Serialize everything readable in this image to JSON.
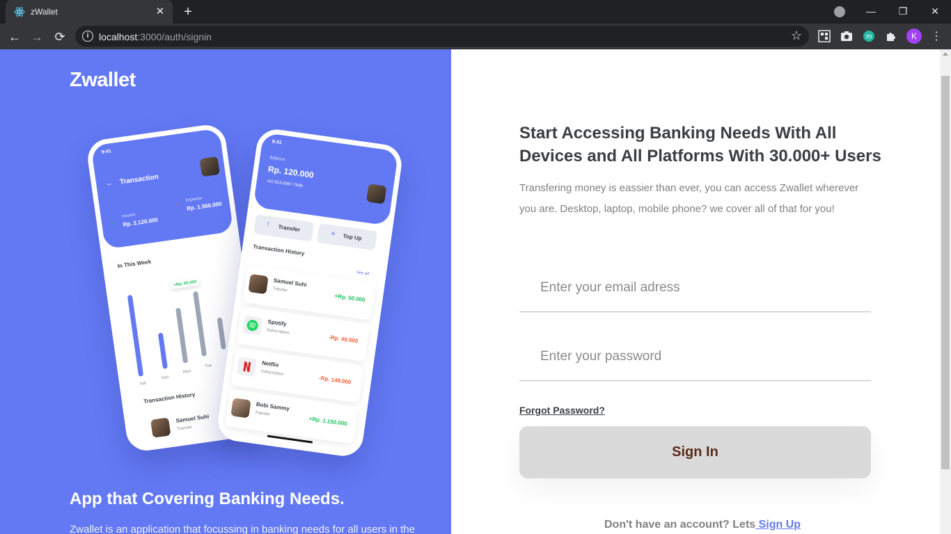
{
  "browser": {
    "tab_title": "zWallet",
    "tab_close": "✕",
    "new_tab": "+",
    "url_host": "localhost",
    "url_path": ":3000/auth/signin",
    "profile_initial": "K",
    "ext_m_label": "m",
    "window_controls": {
      "minimize": "—",
      "maximize": "❐",
      "close": "✕"
    }
  },
  "left": {
    "brand": "Zwallet",
    "heading": "App that Covering Banking Needs.",
    "description": "Zwallet is an application that focussing in banking needs for all users in the"
  },
  "phone_back": {
    "time": "9:41",
    "title": "Transaction",
    "income_label": "Income",
    "income_value": "Rp. 2.120.000",
    "expense_label": "Expense",
    "expense_value": "Rp. 1.560.000",
    "week_title": "In This Week",
    "tooltip": "+Rp. 65.000",
    "days": [
      "Sat",
      "Sun",
      "Mon",
      "Tue"
    ],
    "history_title": "Transaction History",
    "row_name": "Samuel Suhi",
    "row_sub": "Transfer"
  },
  "phone_front": {
    "time": "9:41",
    "balance_label": "Balance",
    "balance_value": "Rp. 120.000",
    "phone_number": "+62 813-9387-7946",
    "transfer_label": "Transfer",
    "topup_label": "Top Up",
    "history_title": "Transaction History",
    "see_all": "See all",
    "transactions": [
      {
        "name": "Samuel Suhi",
        "type": "Transfer",
        "amount": "+Rp. 50.000"
      },
      {
        "name": "Spotify",
        "type": "Subscription",
        "amount": "-Rp. 49.000"
      },
      {
        "name": "Netflix",
        "type": "Subscription",
        "amount": "-Rp. 149.000"
      },
      {
        "name": "Bobi Sammy",
        "type": "Transfer",
        "amount": "+Rp. 1.150.000"
      }
    ]
  },
  "right": {
    "heading": "Start Accessing Banking Needs With All Devices and All Platforms With 30.000+ Users",
    "description": "Transfering money is eassier than ever, you can access Zwallet wherever you are. Desktop, laptop, mobile phone? we cover all of that for you!",
    "email_placeholder": "Enter your email adress",
    "password_placeholder": "Enter your password",
    "forgot_label": "Forgot Password?",
    "signin_label": "Sign In",
    "signup_prompt": "Don't have an account? Lets",
    "signup_link": " Sign Up"
  },
  "colors": {
    "primary": "#6379f4",
    "button_disabled": "#dadada",
    "positive": "#1ec15f",
    "negative": "#ff5b37"
  }
}
